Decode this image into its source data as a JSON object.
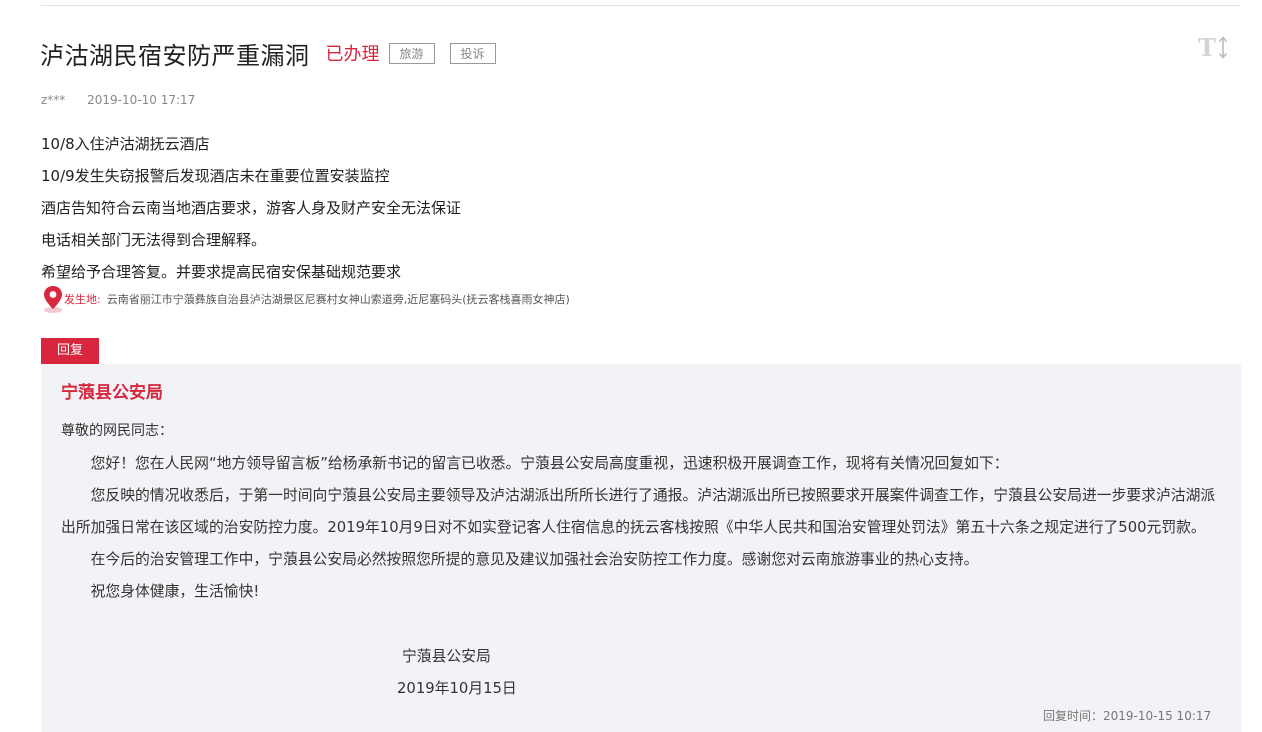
{
  "post": {
    "title": "泸沽湖民宿安防严重漏洞",
    "status": "已办理",
    "tags": [
      "旅游",
      "投诉"
    ],
    "author": "z***",
    "date": "2019-10-10 17:17",
    "body_lines": [
      "10/8入住泸沽湖抚云酒店",
      "10/9发生失窃报警后发现酒店未在重要位置安装监控",
      "酒店告知符合云南当地酒店要求，游客人身及财产安全无法保证",
      "电话相关部门无法得到合理解释。",
      "希望给予合理答复。并要求提高民宿安保基础规范要求"
    ],
    "location_label": "发生地:",
    "location_text": "云南省丽江市宁蒗彝族自治县泸沽湖景区尼赛村女神山索道旁,近尼塞码头(抚云客栈喜雨女神店)",
    "location_icon": "map-pin-icon",
    "font_toggle_icon": "text-size-icon"
  },
  "reply": {
    "tab_label": "回复",
    "org": "宁蒗县公安局",
    "salutation": "尊敬的网民同志：",
    "paragraphs": [
      "您好！您在人民网“地方领导留言板”给杨承新书记的留言已收悉。宁蒗县公安局高度重视，迅速积极开展调查工作，现将有关情况回复如下：",
      "您反映的情况收悉后，于第一时间向宁蒗县公安局主要领导及泸沽湖派出所所长进行了通报。泸沽湖派出所已按照要求开展案件调查工作，宁蒗县公安局进一步要求泸沽湖派出所加强日常在该区域的治安防控力度。2019年10月9日对不如实登记客人住宿信息的抚云客栈按照《中华人民共和国治安管理处罚法》第五十六条之规定进行了500元罚款。",
      "在今后的治安管理工作中，宁蒗县公安局必然按照您所提的意见及建议加强社会治安防控工作力度。感谢您对云南旅游事业的热心支持。",
      "祝您身体健康，生活愉快!"
    ],
    "signature_org": "宁蒗县公安局",
    "signature_date": "2019年10月15日",
    "reply_time": "回复时间：2019-10-15 10:17"
  },
  "colors": {
    "accent_red": "#d7263d",
    "reply_bg": "#f2f3f6",
    "tag_border": "#999999"
  }
}
